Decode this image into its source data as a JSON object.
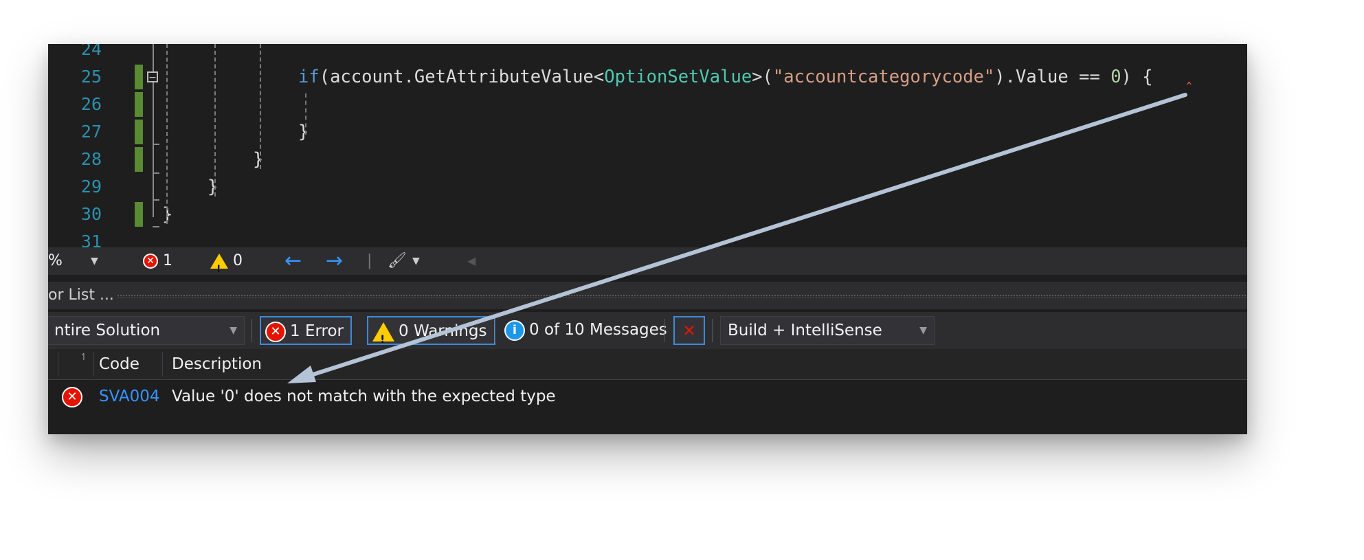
{
  "editor": {
    "lines": [
      {
        "num": "24"
      },
      {
        "num": "25"
      },
      {
        "num": "26"
      },
      {
        "num": "27"
      },
      {
        "num": "28"
      },
      {
        "num": "29"
      },
      {
        "num": "30"
      },
      {
        "num": "31"
      }
    ],
    "code_line_25": {
      "kw": "if",
      "p1": "(account.GetAttributeValue<",
      "cls": "OptionSetValue",
      "p2": ">(",
      "str": "\"accountcategorycode\"",
      "p3": ").Value == ",
      "num": "0",
      "p4": ") {"
    },
    "brace_27": "}",
    "brace_28": "}",
    "brace_29": "}",
    "brace_30": "}"
  },
  "strip": {
    "zoom": "%",
    "errors": "1",
    "warnings": "0"
  },
  "error_list": {
    "title": "or List ...",
    "scope": "ntire Solution",
    "errors_label": "1 Error",
    "warnings_label": "0 Warnings",
    "messages_label": "0 of 10 Messages",
    "source": "Build + IntelliSense",
    "columns": {
      "code": "Code",
      "description": "Description"
    },
    "rows": [
      {
        "code": "SVA004",
        "description": "Value '0' does not match with the expected type"
      }
    ]
  },
  "colors": {
    "background": "#1e1e1e",
    "keyword": "#569cd6",
    "type": "#4ec9b0",
    "string": "#d69d85",
    "number": "#b5cea8",
    "line_number": "#2b91af",
    "error": "#e51400",
    "accent": "#3794ff",
    "annotation_arrow": "#b4c3d6"
  }
}
